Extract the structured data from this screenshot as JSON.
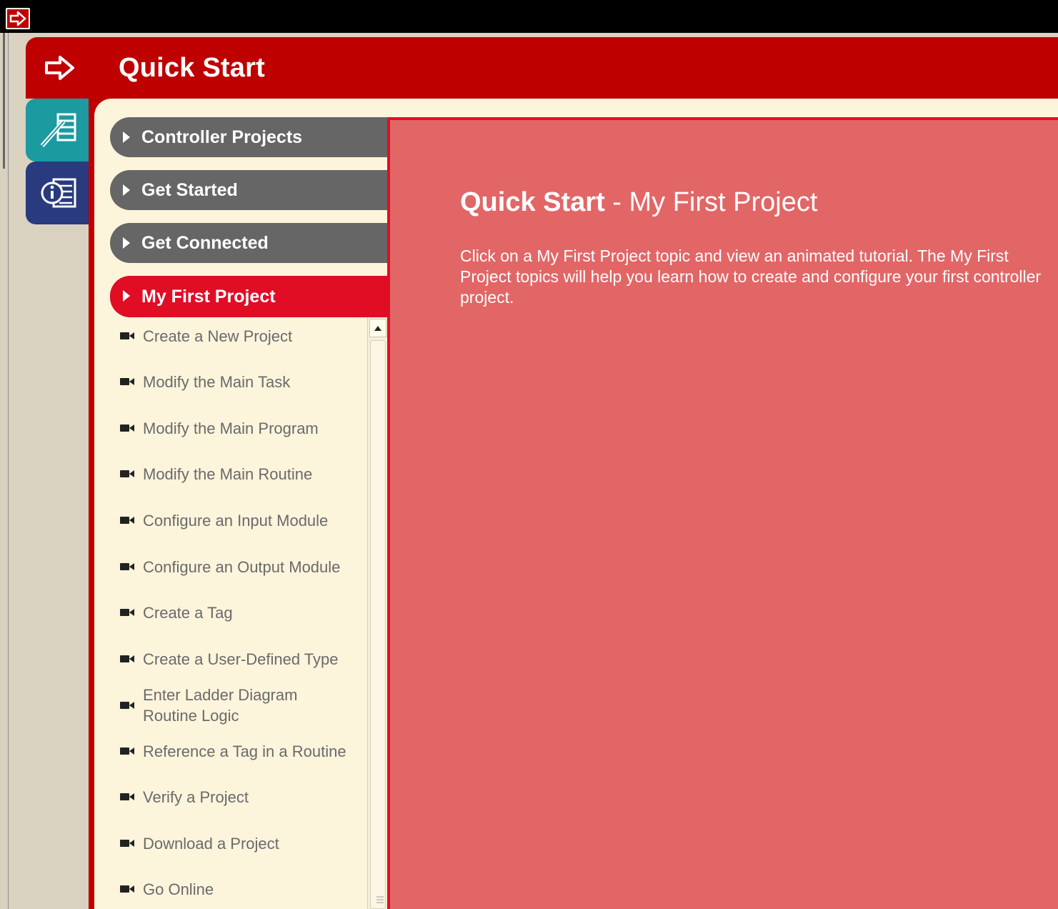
{
  "window": {
    "title": ""
  },
  "header": {
    "title": "Quick Start"
  },
  "side_tabs": [
    {
      "icon": "ladder-edit-icon"
    },
    {
      "icon": "info-document-icon"
    }
  ],
  "nav": {
    "items": [
      {
        "label": "Controller Projects",
        "active": false
      },
      {
        "label": "Get Started",
        "active": false
      },
      {
        "label": "Get Connected",
        "active": false
      },
      {
        "label": "My First Project",
        "active": true
      }
    ]
  },
  "topics": [
    {
      "label": "Create a New Project"
    },
    {
      "label": "Modify the Main Task"
    },
    {
      "label": "Modify the Main Program"
    },
    {
      "label": "Modify the Main Routine"
    },
    {
      "label": "Configure an Input Module"
    },
    {
      "label": "Configure an Output Module"
    },
    {
      "label": "Create a Tag"
    },
    {
      "label": "Create a User-Defined Type"
    },
    {
      "label": "Enter Ladder Diagram Routine Logic"
    },
    {
      "label": "Reference a Tag in a Routine"
    },
    {
      "label": "Verify a Project"
    },
    {
      "label": "Download a Project"
    },
    {
      "label": "Go Online"
    }
  ],
  "content": {
    "title_bold": "Quick Start",
    "title_rest": " - My First Project",
    "body": "Click on a My First Project topic and view an animated tutorial. The My First Project topics will help you learn how to create and configure your first controller project."
  },
  "colors": {
    "header_red": "#bf0000",
    "active_red": "#e00d25",
    "content_pink": "#e26666",
    "pill_gray": "#666666",
    "panel_cream": "#fdf4dc",
    "tab_teal": "#1b9aa0",
    "tab_navy": "#2a3a7e"
  }
}
